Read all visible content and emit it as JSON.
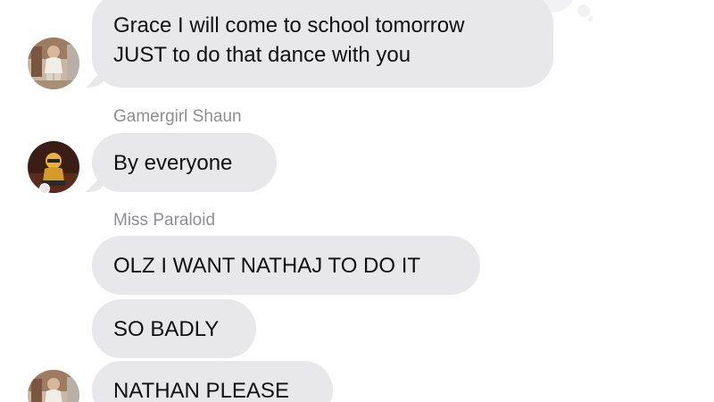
{
  "messages": [
    {
      "sender": "",
      "text": "Grace I will come to school tomorrow\nJUST to do that dance with you",
      "avatar": "person-standing-avatar"
    },
    {
      "sender": "Gamergirl Shaun",
      "text": "By everyone",
      "avatar": "figure-photo-avatar"
    },
    {
      "sender": "Miss Paraloid",
      "text": "OLZ I WANT NATHAJ TO DO IT",
      "avatar": ""
    },
    {
      "sender": "",
      "text": "SO BADLY",
      "avatar": ""
    },
    {
      "sender": "",
      "text": "NATHAN PLEASE",
      "avatar": "person-standing-avatar"
    }
  ],
  "reaction": {
    "icon": "heart-icon",
    "color": "#ff5a8a"
  },
  "colors": {
    "bubble": "#e8e8ea",
    "sender": "#8e8e93",
    "text": "#111111"
  }
}
